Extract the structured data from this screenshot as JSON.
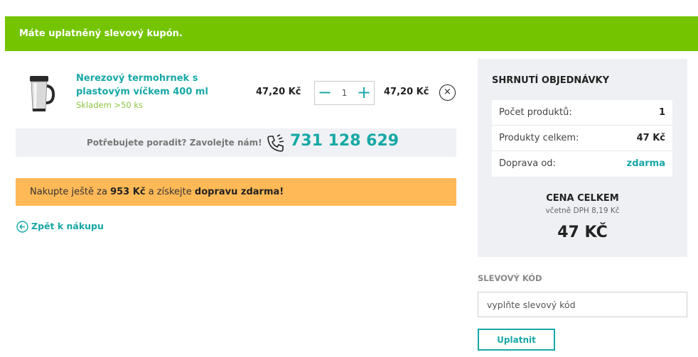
{
  "banner": {
    "text": "Máte uplatněný slevový kupón."
  },
  "cart": {
    "item": {
      "image_icon": "thermo-mug",
      "name": "Nerezový termohrnek s plastovým víčkem 400 ml",
      "stock": "Skladem >50 ks",
      "unit_price": "47,20 Kč",
      "quantity": "1",
      "minus_label": "−",
      "plus_label": "+",
      "total_price": "47,20 Kč",
      "remove_label": "×"
    },
    "help": {
      "text": "Potřebujete poradit? Zavolejte nám!",
      "phone": "731 128 629"
    },
    "shipping": {
      "prefix": "Nakupte ještě za",
      "amount": "953 Kč",
      "middle": "a získejte",
      "highlight": "dopravu zdarma",
      "suffix": "!"
    },
    "back_label": "Zpět k nákupu"
  },
  "summary": {
    "title": "SHRNUTÍ OBJEDNÁVKY",
    "rows": [
      {
        "label": "Počet produktů:",
        "value": "1"
      },
      {
        "label": "Produkty celkem:",
        "value": "47 Kč"
      },
      {
        "label": "Doprava od:",
        "value": "zdarma"
      }
    ],
    "total_label": "CENA CELKEM",
    "vat_note": "včetně DPH 8,19 Kč",
    "total_value": "47 KČ"
  },
  "coupon": {
    "label": "SLEVOVÝ KÓD",
    "placeholder": "vyplňte slevový kód",
    "value": "",
    "button": "Uplatnit"
  },
  "colors": {
    "banner": "#74c400",
    "accent": "#17a8a6",
    "shipping": "#ffb957",
    "stock": "#8cc63f"
  }
}
